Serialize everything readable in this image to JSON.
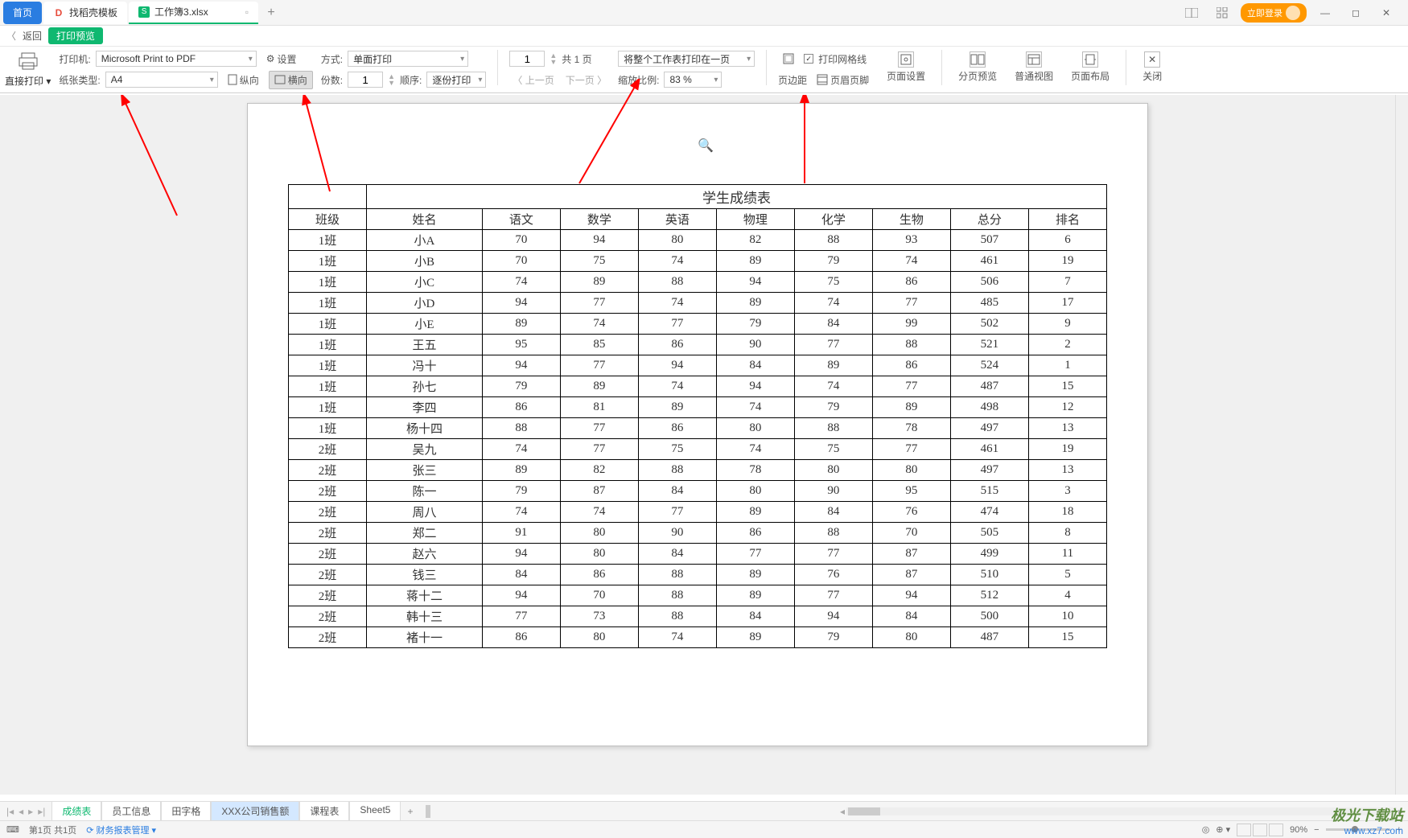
{
  "tabs": {
    "home": "首页",
    "template": "找稻壳模板",
    "workbook": "工作簿3.xlsx"
  },
  "top_right": {
    "login": "立即登录"
  },
  "breadcrumb": {
    "back": "返回",
    "title": "打印预览"
  },
  "toolbar": {
    "direct_print": "直接打印",
    "printer_label": "打印机:",
    "printer_value": "Microsoft Print to PDF",
    "settings": "设置",
    "paper_label": "纸张类型:",
    "paper_value": "A4",
    "portrait": "纵向",
    "landscape": "横向",
    "mode_label": "方式:",
    "mode_value": "单面打印",
    "copies_label": "份数:",
    "copies_value": "1",
    "order_label": "顺序:",
    "order_value": "逐份打印",
    "page_input": "1",
    "page_total": "共 1 页",
    "prev_page": "上一页",
    "next_page": "下一页",
    "scale_mode": "将整个工作表打印在一页",
    "scale_label": "缩放比例:",
    "scale_value": "83 %",
    "margins": "页边距",
    "header_footer": "页眉页脚",
    "grid_check": "打印网格线",
    "page_setup": "页面设置",
    "page_break": "分页预览",
    "normal_view": "普通视图",
    "page_layout": "页面布局",
    "close": "关闭"
  },
  "table": {
    "title": "学生成绩表",
    "headers": [
      "班级",
      "姓名",
      "语文",
      "数学",
      "英语",
      "物理",
      "化学",
      "生物",
      "总分",
      "排名"
    ],
    "rows": [
      [
        "1班",
        "小A",
        "70",
        "94",
        "80",
        "82",
        "88",
        "93",
        "507",
        "6"
      ],
      [
        "1班",
        "小B",
        "70",
        "75",
        "74",
        "89",
        "79",
        "74",
        "461",
        "19"
      ],
      [
        "1班",
        "小C",
        "74",
        "89",
        "88",
        "94",
        "75",
        "86",
        "506",
        "7"
      ],
      [
        "1班",
        "小D",
        "94",
        "77",
        "74",
        "89",
        "74",
        "77",
        "485",
        "17"
      ],
      [
        "1班",
        "小E",
        "89",
        "74",
        "77",
        "79",
        "84",
        "99",
        "502",
        "9"
      ],
      [
        "1班",
        "王五",
        "95",
        "85",
        "86",
        "90",
        "77",
        "88",
        "521",
        "2"
      ],
      [
        "1班",
        "冯十",
        "94",
        "77",
        "94",
        "84",
        "89",
        "86",
        "524",
        "1"
      ],
      [
        "1班",
        "孙七",
        "79",
        "89",
        "74",
        "94",
        "74",
        "77",
        "487",
        "15"
      ],
      [
        "1班",
        "李四",
        "86",
        "81",
        "89",
        "74",
        "79",
        "89",
        "498",
        "12"
      ],
      [
        "1班",
        "杨十四",
        "88",
        "77",
        "86",
        "80",
        "88",
        "78",
        "497",
        "13"
      ],
      [
        "2班",
        "吴九",
        "74",
        "77",
        "75",
        "74",
        "75",
        "77",
        "461",
        "19"
      ],
      [
        "2班",
        "张三",
        "89",
        "82",
        "88",
        "78",
        "80",
        "80",
        "497",
        "13"
      ],
      [
        "2班",
        "陈一",
        "79",
        "87",
        "84",
        "80",
        "90",
        "95",
        "515",
        "3"
      ],
      [
        "2班",
        "周八",
        "74",
        "74",
        "77",
        "89",
        "84",
        "76",
        "474",
        "18"
      ],
      [
        "2班",
        "郑二",
        "91",
        "80",
        "90",
        "86",
        "88",
        "70",
        "505",
        "8"
      ],
      [
        "2班",
        "赵六",
        "94",
        "80",
        "84",
        "77",
        "77",
        "87",
        "499",
        "11"
      ],
      [
        "2班",
        "钱三",
        "84",
        "86",
        "88",
        "89",
        "76",
        "87",
        "510",
        "5"
      ],
      [
        "2班",
        "蒋十二",
        "94",
        "70",
        "88",
        "89",
        "77",
        "94",
        "512",
        "4"
      ],
      [
        "2班",
        "韩十三",
        "77",
        "73",
        "88",
        "84",
        "94",
        "84",
        "500",
        "10"
      ],
      [
        "2班",
        "褚十一",
        "86",
        "80",
        "74",
        "89",
        "79",
        "80",
        "487",
        "15"
      ]
    ]
  },
  "sheets": {
    "items": [
      "成绩表",
      "员工信息",
      "田字格",
      "XXX公司销售额",
      "课程表",
      "Sheet5"
    ],
    "active_index": 0,
    "highlight_index": 3
  },
  "status": {
    "page_info": "第1页 共1页",
    "workbook_link": "财务报表管理",
    "zoom": "90%"
  },
  "watermark": {
    "logo": "极光下载站",
    "url": "www.xz7.com"
  },
  "chart_data": {
    "type": "table",
    "title": "学生成绩表",
    "columns": [
      "班级",
      "姓名",
      "语文",
      "数学",
      "英语",
      "物理",
      "化学",
      "生物",
      "总分",
      "排名"
    ],
    "rows": [
      [
        "1班",
        "小A",
        70,
        94,
        80,
        82,
        88,
        93,
        507,
        6
      ],
      [
        "1班",
        "小B",
        70,
        75,
        74,
        89,
        79,
        74,
        461,
        19
      ],
      [
        "1班",
        "小C",
        74,
        89,
        88,
        94,
        75,
        86,
        506,
        7
      ],
      [
        "1班",
        "小D",
        94,
        77,
        74,
        89,
        74,
        77,
        485,
        17
      ],
      [
        "1班",
        "小E",
        89,
        74,
        77,
        79,
        84,
        99,
        502,
        9
      ],
      [
        "1班",
        "王五",
        95,
        85,
        86,
        90,
        77,
        88,
        521,
        2
      ],
      [
        "1班",
        "冯十",
        94,
        77,
        94,
        84,
        89,
        86,
        524,
        1
      ],
      [
        "1班",
        "孙七",
        79,
        89,
        74,
        94,
        74,
        77,
        487,
        15
      ],
      [
        "1班",
        "李四",
        86,
        81,
        89,
        74,
        79,
        89,
        498,
        12
      ],
      [
        "1班",
        "杨十四",
        88,
        77,
        86,
        80,
        88,
        78,
        497,
        13
      ],
      [
        "2班",
        "吴九",
        74,
        77,
        75,
        74,
        75,
        77,
        461,
        19
      ],
      [
        "2班",
        "张三",
        89,
        82,
        88,
        78,
        80,
        80,
        497,
        13
      ],
      [
        "2班",
        "陈一",
        79,
        87,
        84,
        80,
        90,
        95,
        515,
        3
      ],
      [
        "2班",
        "周八",
        74,
        74,
        77,
        89,
        84,
        76,
        474,
        18
      ],
      [
        "2班",
        "郑二",
        91,
        80,
        90,
        86,
        88,
        70,
        505,
        8
      ],
      [
        "2班",
        "赵六",
        94,
        80,
        84,
        77,
        77,
        87,
        499,
        11
      ],
      [
        "2班",
        "钱三",
        84,
        86,
        88,
        89,
        76,
        87,
        510,
        5
      ],
      [
        "2班",
        "蒋十二",
        94,
        70,
        88,
        89,
        77,
        94,
        512,
        4
      ],
      [
        "2班",
        "韩十三",
        77,
        73,
        88,
        84,
        94,
        84,
        500,
        10
      ],
      [
        "2班",
        "褚十一",
        86,
        80,
        74,
        89,
        79,
        80,
        487,
        15
      ]
    ]
  }
}
